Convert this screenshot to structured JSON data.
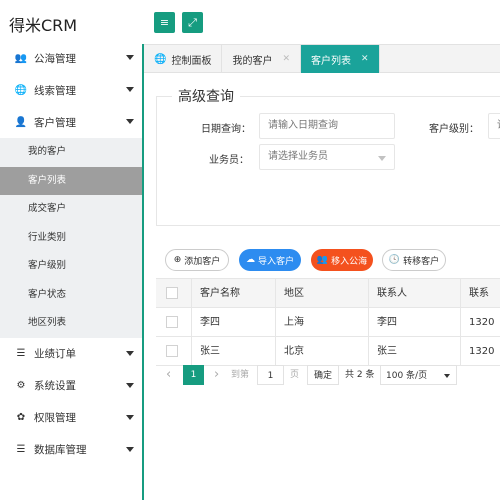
{
  "app": {
    "title": "得米CRM"
  },
  "toolbar": {
    "menu_icon": "≡",
    "fullscreen_icon": "⤢"
  },
  "sidebar": {
    "items": [
      {
        "label": "公海管理",
        "icon": "👥"
      },
      {
        "label": "线索管理",
        "icon": "🌐"
      },
      {
        "label": "客户管理",
        "icon": "👤",
        "expanded": true
      },
      {
        "label": "业绩订单",
        "icon": "☰"
      },
      {
        "label": "系统设置",
        "icon": "⚙"
      },
      {
        "label": "权限管理",
        "icon": "✿"
      },
      {
        "label": "数据库管理",
        "icon": "☰"
      }
    ],
    "customer_submenu": [
      "我的客户",
      "客户列表",
      "成交客户",
      "行业类别",
      "客户级别",
      "客户状态",
      "地区列表"
    ],
    "active_sub": "客户列表"
  },
  "tabs": [
    {
      "label": "控制面板",
      "closable": false
    },
    {
      "label": "我的客户",
      "closable": true
    },
    {
      "label": "客户列表",
      "closable": true,
      "active": true
    }
  ],
  "search": {
    "legend": "高级查询",
    "date_label": "日期查询：",
    "date_placeholder": "请输入日期查询",
    "level_label": "客户级别：",
    "level_value": "请",
    "staff_label": "业务员：",
    "staff_placeholder": "请选择业务员"
  },
  "actions": {
    "add": "添加客户",
    "import": "导入客户",
    "to_pool": "移入公海",
    "transfer": "转移客户"
  },
  "table": {
    "columns": [
      "客户名称",
      "地区",
      "联系人",
      "联系"
    ],
    "rows": [
      [
        "李四",
        "上海",
        "李四",
        "1320"
      ],
      [
        "张三",
        "北京",
        "张三",
        "1320"
      ]
    ]
  },
  "pagination": {
    "prev": "‹",
    "current": "1",
    "next": "›",
    "goto_label": "到第",
    "goto_value": "1",
    "page_unit": "页",
    "confirm": "确定",
    "total": "共 2 条",
    "page_size": "100 条/页"
  },
  "colors": {
    "accent": "#169c80",
    "tab_active": "#1aa39a",
    "import": "#2d8cf0",
    "pool": "#f4511e"
  }
}
